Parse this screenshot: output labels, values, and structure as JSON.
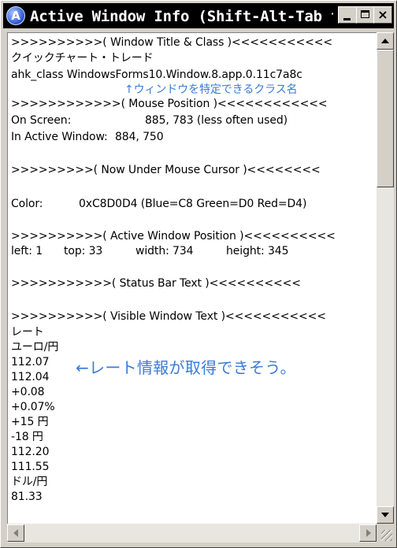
{
  "window": {
    "title": "Active Window Info (Shift-Alt-Tab t...",
    "icon_letter": "A",
    "controls": {
      "minimize": "minimize-icon",
      "maximize": "maximize-icon",
      "close": "×"
    }
  },
  "info": {
    "sec_title_class": ">>>>>>>>>>( Window Title & Class )<<<<<<<<<<<",
    "window_title": "クイックチャート・トレード",
    "ahk_class": "ahk_class WindowsForms10.Window.8.app.0.11c7a8c",
    "class_note": "↑ウィンドウを特定できるクラス名",
    "sec_mouse": ">>>>>>>>>>>>( Mouse Position )<<<<<<<<<<<<",
    "on_screen_label": "On Screen:",
    "on_screen_value": "885, 783  (less often used)",
    "in_active_label": "In Active Window:",
    "in_active_value": "884, 750",
    "sec_under_mouse": ">>>>>>>>>( Now Under Mouse Cursor )<<<<<<<<",
    "color_label": "Color:",
    "color_value": "0xC8D0D4  (Blue=C8 Green=D0 Red=D4)",
    "sec_position": ">>>>>>>>>>( Active Window Position )<<<<<<<<<<",
    "left": "left: 1",
    "top": "top: 33",
    "width": "width: 734",
    "height": "height: 345",
    "sec_status": ">>>>>>>>>>>( Status Bar Text )<<<<<<<<<<",
    "sec_visible": ">>>>>>>>>>( Visible Window Text )<<<<<<<<<<<",
    "rate_note": "←レート情報が取得できそう。",
    "visible_text": [
      "レート",
      "ユーロ/円",
      "112.07",
      "112.04",
      "+0.08",
      "+0.07%",
      "+15 円",
      "-18 円",
      "112.20",
      "111.55",
      "ドル/円",
      "81.33"
    ]
  },
  "colors": {
    "titlebar_bg": "#000000",
    "face": "#d4d0c8",
    "note_blue": "#3a7bd8"
  }
}
